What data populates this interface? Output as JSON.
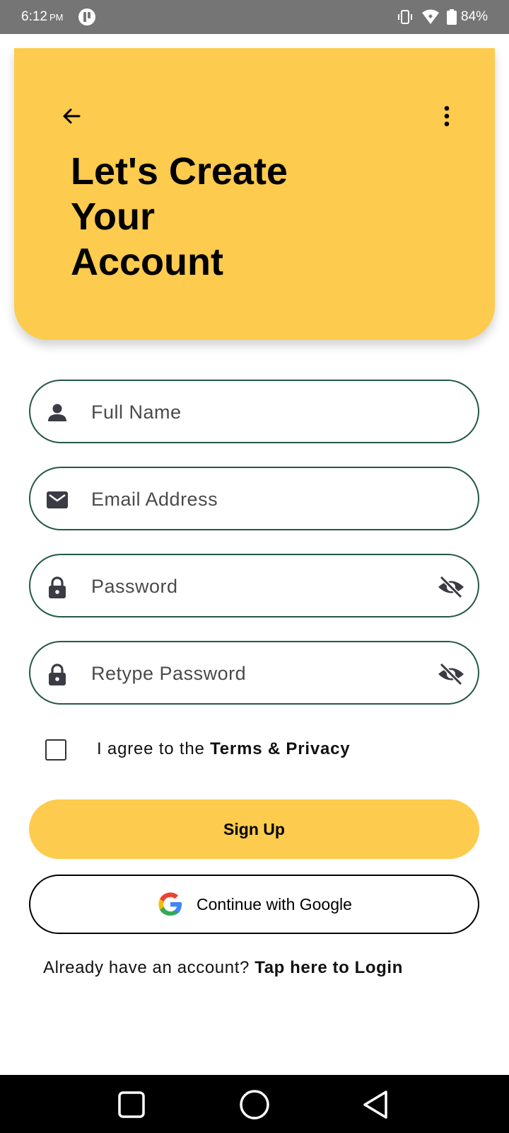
{
  "status_bar": {
    "time": "6:12",
    "ampm": "PM",
    "battery": "84%"
  },
  "header": {
    "title_lines": [
      "Let's Create",
      "Your",
      "Account"
    ],
    "background_color": "#fdcb4d",
    "back_icon": "arrow-left-icon",
    "menu_icon": "more-vertical-icon"
  },
  "form": {
    "full_name": {
      "placeholder": "Full Name",
      "value": "",
      "icon": "person-icon"
    },
    "email": {
      "placeholder": "Email Address",
      "value": "",
      "icon": "mail-icon"
    },
    "password": {
      "placeholder": "Password",
      "value": "",
      "icon": "lock-icon",
      "toggle_icon": "eye-off-icon"
    },
    "retype_password": {
      "placeholder": "Retype Password",
      "value": "",
      "icon": "lock-icon",
      "toggle_icon": "eye-off-icon"
    },
    "field_border_color": "#24584a"
  },
  "terms": {
    "checked": false,
    "prefix": "I agree to the",
    "link": "Terms & Privacy"
  },
  "actions": {
    "signup_label": "Sign Up",
    "google_label": "Continue with Google"
  },
  "footer": {
    "prompt": "Already have an account?",
    "login_link": "Tap here to Login"
  }
}
